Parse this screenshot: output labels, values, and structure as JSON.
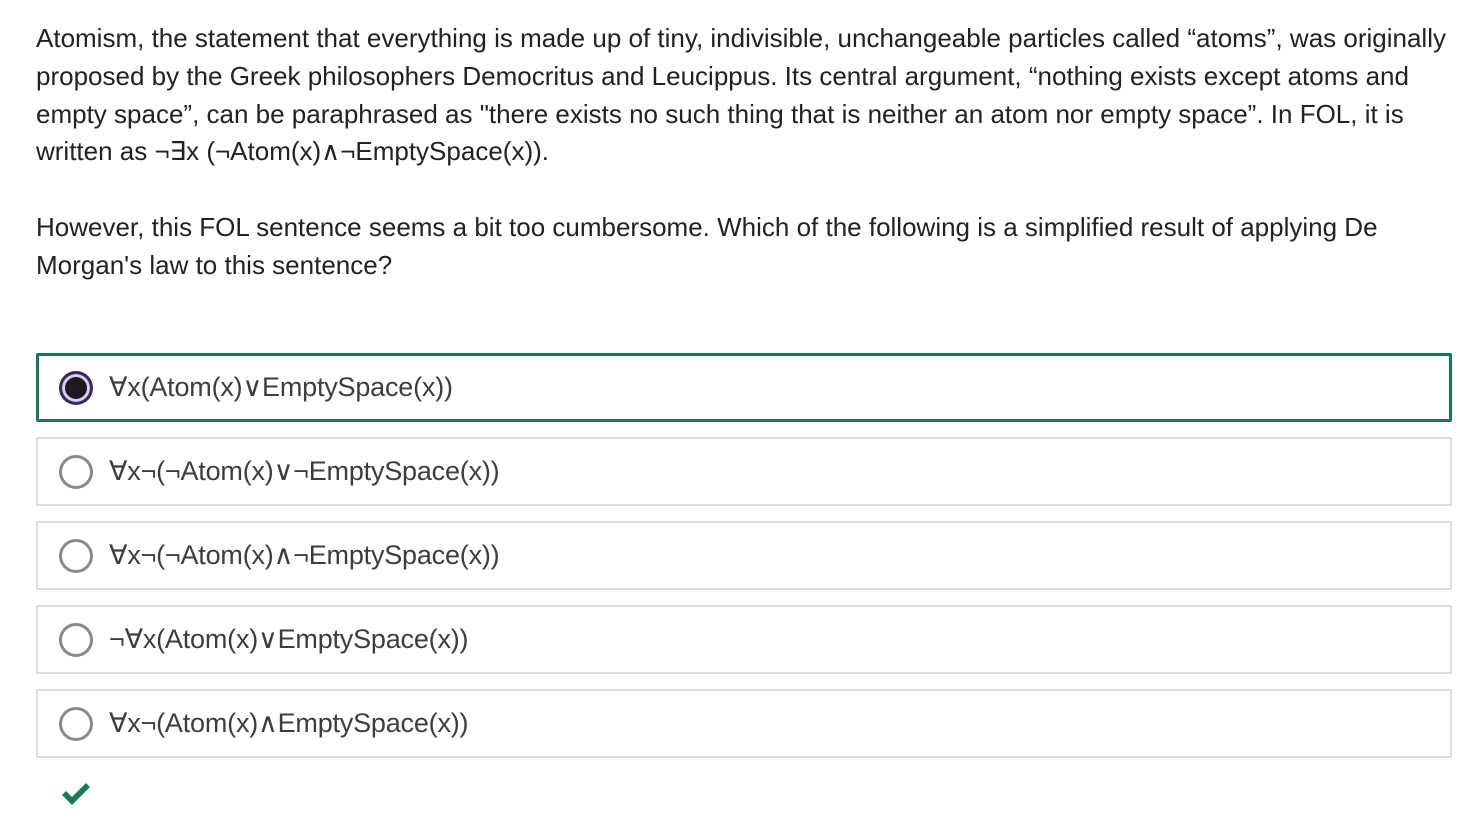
{
  "question": {
    "paragraph1": "Atomism, the statement that everything is made up of tiny, indivisible, unchangeable particles called “atoms”, was originally proposed by the Greek philosophers Democritus and Leucippus. Its central argument, “nothing exists except atoms and empty space”, can be paraphrased as \"there exists no such thing that is neither an atom nor empty space”. In FOL, it is written as ¬∃x (¬Atom(x)∧¬EmptySpace(x)).",
    "paragraph2": "However, this FOL sentence seems a bit too cumbersome. Which of the following is a simplified result of applying De Morgan's law to this sentence?"
  },
  "options": [
    {
      "label": "∀x(Atom(x)∨EmptySpace(x))",
      "selected": true
    },
    {
      "label": "∀x¬(¬Atom(x)∨¬EmptySpace(x))",
      "selected": false
    },
    {
      "label": "∀x¬(¬Atom(x)∧¬EmptySpace(x))",
      "selected": false
    },
    {
      "label": "¬∀x(Atom(x)∨EmptySpace(x))",
      "selected": false
    },
    {
      "label": "∀x¬(Atom(x)∧EmptySpace(x))",
      "selected": false
    }
  ],
  "feedback": {
    "icon": "checkmark-icon",
    "color": "#177a54"
  },
  "colors": {
    "selected_border": "#177a54",
    "option_border": "#dcdcdc"
  }
}
